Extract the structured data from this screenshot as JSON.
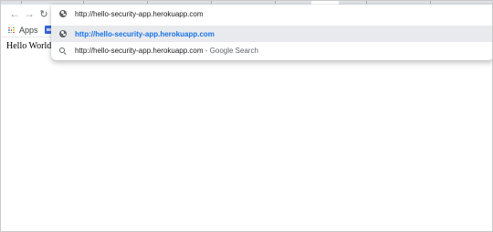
{
  "browser": {
    "toolbar": {
      "back_icon": "arrow-left-icon",
      "forward_icon": "arrow-right-icon",
      "reload_icon": "reload-icon"
    },
    "omnibox": {
      "input_value": "http://hello-security-app.herokuapp.com",
      "suggestions": [
        {
          "icon": "globe-icon",
          "text": "http://hello-security-app.herokuapp.com",
          "selected": true
        },
        {
          "icon": "search-icon",
          "text": "http://hello-security-app.herokuapp.com",
          "suffix": " - Google Search",
          "selected": false
        }
      ]
    },
    "bookmarks_bar": {
      "apps_label": "Apps",
      "apps_icon_colors": [
        "#ea4335",
        "#fbbc04",
        "#34a853",
        "#4285f4",
        "#ea4335",
        "#fbbc04",
        "#34a853",
        "#4285f4",
        "#ea4335"
      ]
    }
  },
  "page": {
    "body_text": "Hello World!"
  },
  "colors": {
    "accent": "#1a73e8",
    "selected_row": "#e8eaed"
  }
}
